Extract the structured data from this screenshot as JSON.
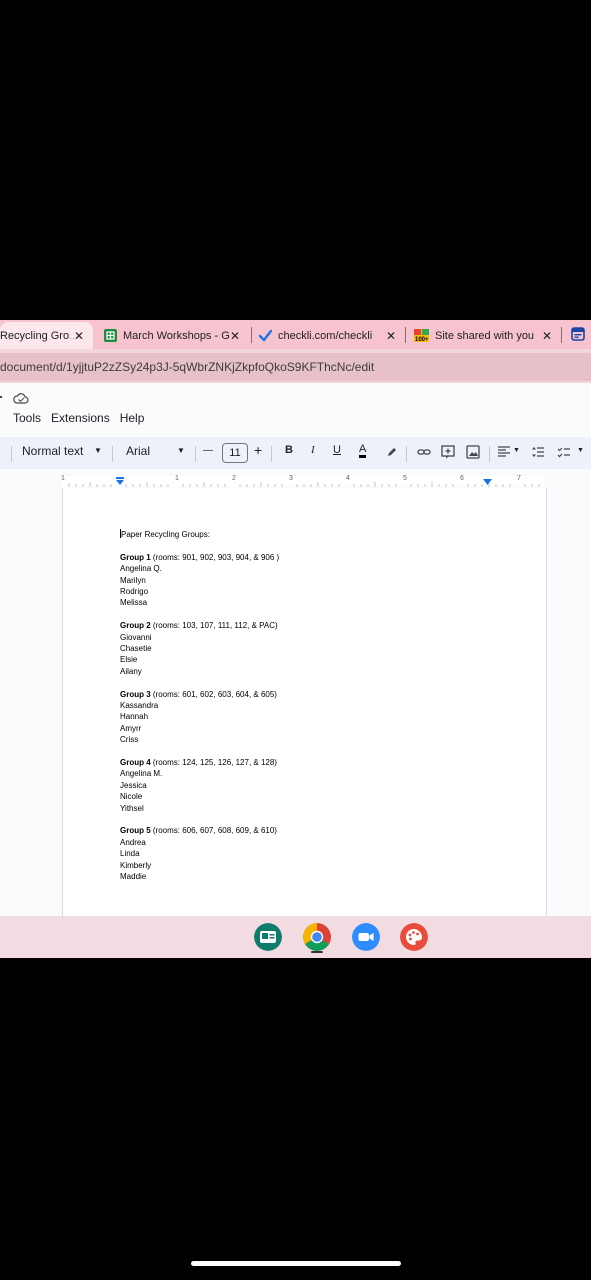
{
  "tabs": [
    {
      "title": "Recycling Gro",
      "active": true
    },
    {
      "title": "March Workshops - G",
      "icon": "google-sheets-icon"
    },
    {
      "title": "checkli.com/checkli",
      "icon": "checkmark-icon"
    },
    {
      "title": "Site shared with you",
      "icon": "site-badge-icon"
    }
  ],
  "address_bar": {
    "url": "document/d/1yjjtuP2zZSy24p3J-5qWbrZNKjZkpfoQkoS9KFThcNc/edit"
  },
  "docs_menu": {
    "items": [
      "Tools",
      "Extensions",
      "Help"
    ]
  },
  "toolbar": {
    "style": "Normal text",
    "font": "Arial",
    "minus": "—",
    "font_size": "11",
    "plus": "+",
    "bold": "B",
    "italic": "I",
    "underline": "U",
    "text_color": "A"
  },
  "ruler": {
    "numbers": [
      "1",
      "1",
      "2",
      "3",
      "4",
      "5",
      "6",
      "7"
    ]
  },
  "document": {
    "heading": "Paper Recycling Groups:",
    "groups": [
      {
        "label": "Group 1",
        "rooms": " (rooms: 901, 902, 903, 904, & 906 )",
        "members": [
          "Angelina Q.",
          "Marilyn",
          "Rodrigo",
          "Melissa"
        ]
      },
      {
        "label": "Group 2",
        "rooms": " (rooms: 103, 107, 111, 112, & PAC)",
        "members": [
          "Giovanni",
          "Chasetie",
          "Elsie",
          "Ailany"
        ]
      },
      {
        "label": "Group 3",
        "rooms": " (rooms: 601, 602, 603, 604, & 605)",
        "members": [
          "Kassandra",
          "Hannah",
          "Amyrr",
          "Criss"
        ]
      },
      {
        "label": "Group 4",
        "rooms": " (rooms: 124, 125, 126, 127, & 128)",
        "members": [
          "Angelina M.",
          "Jessica",
          "Nicole",
          "Yithsel"
        ]
      },
      {
        "label": "Group 5",
        "rooms": " (rooms: 606, 607, 608, 609, & 610)",
        "members": [
          "Andrea",
          "Linda",
          "Kimberly",
          "Maddie"
        ]
      }
    ]
  },
  "shelf": {
    "apps": [
      "classroom-icon",
      "chrome-icon",
      "zoom-icon",
      "palette-icon"
    ]
  },
  "colors": {
    "tabstrip": "#f6c3cf",
    "toolbar": "#edf2fa",
    "accent_blue": "#1a73e8"
  }
}
